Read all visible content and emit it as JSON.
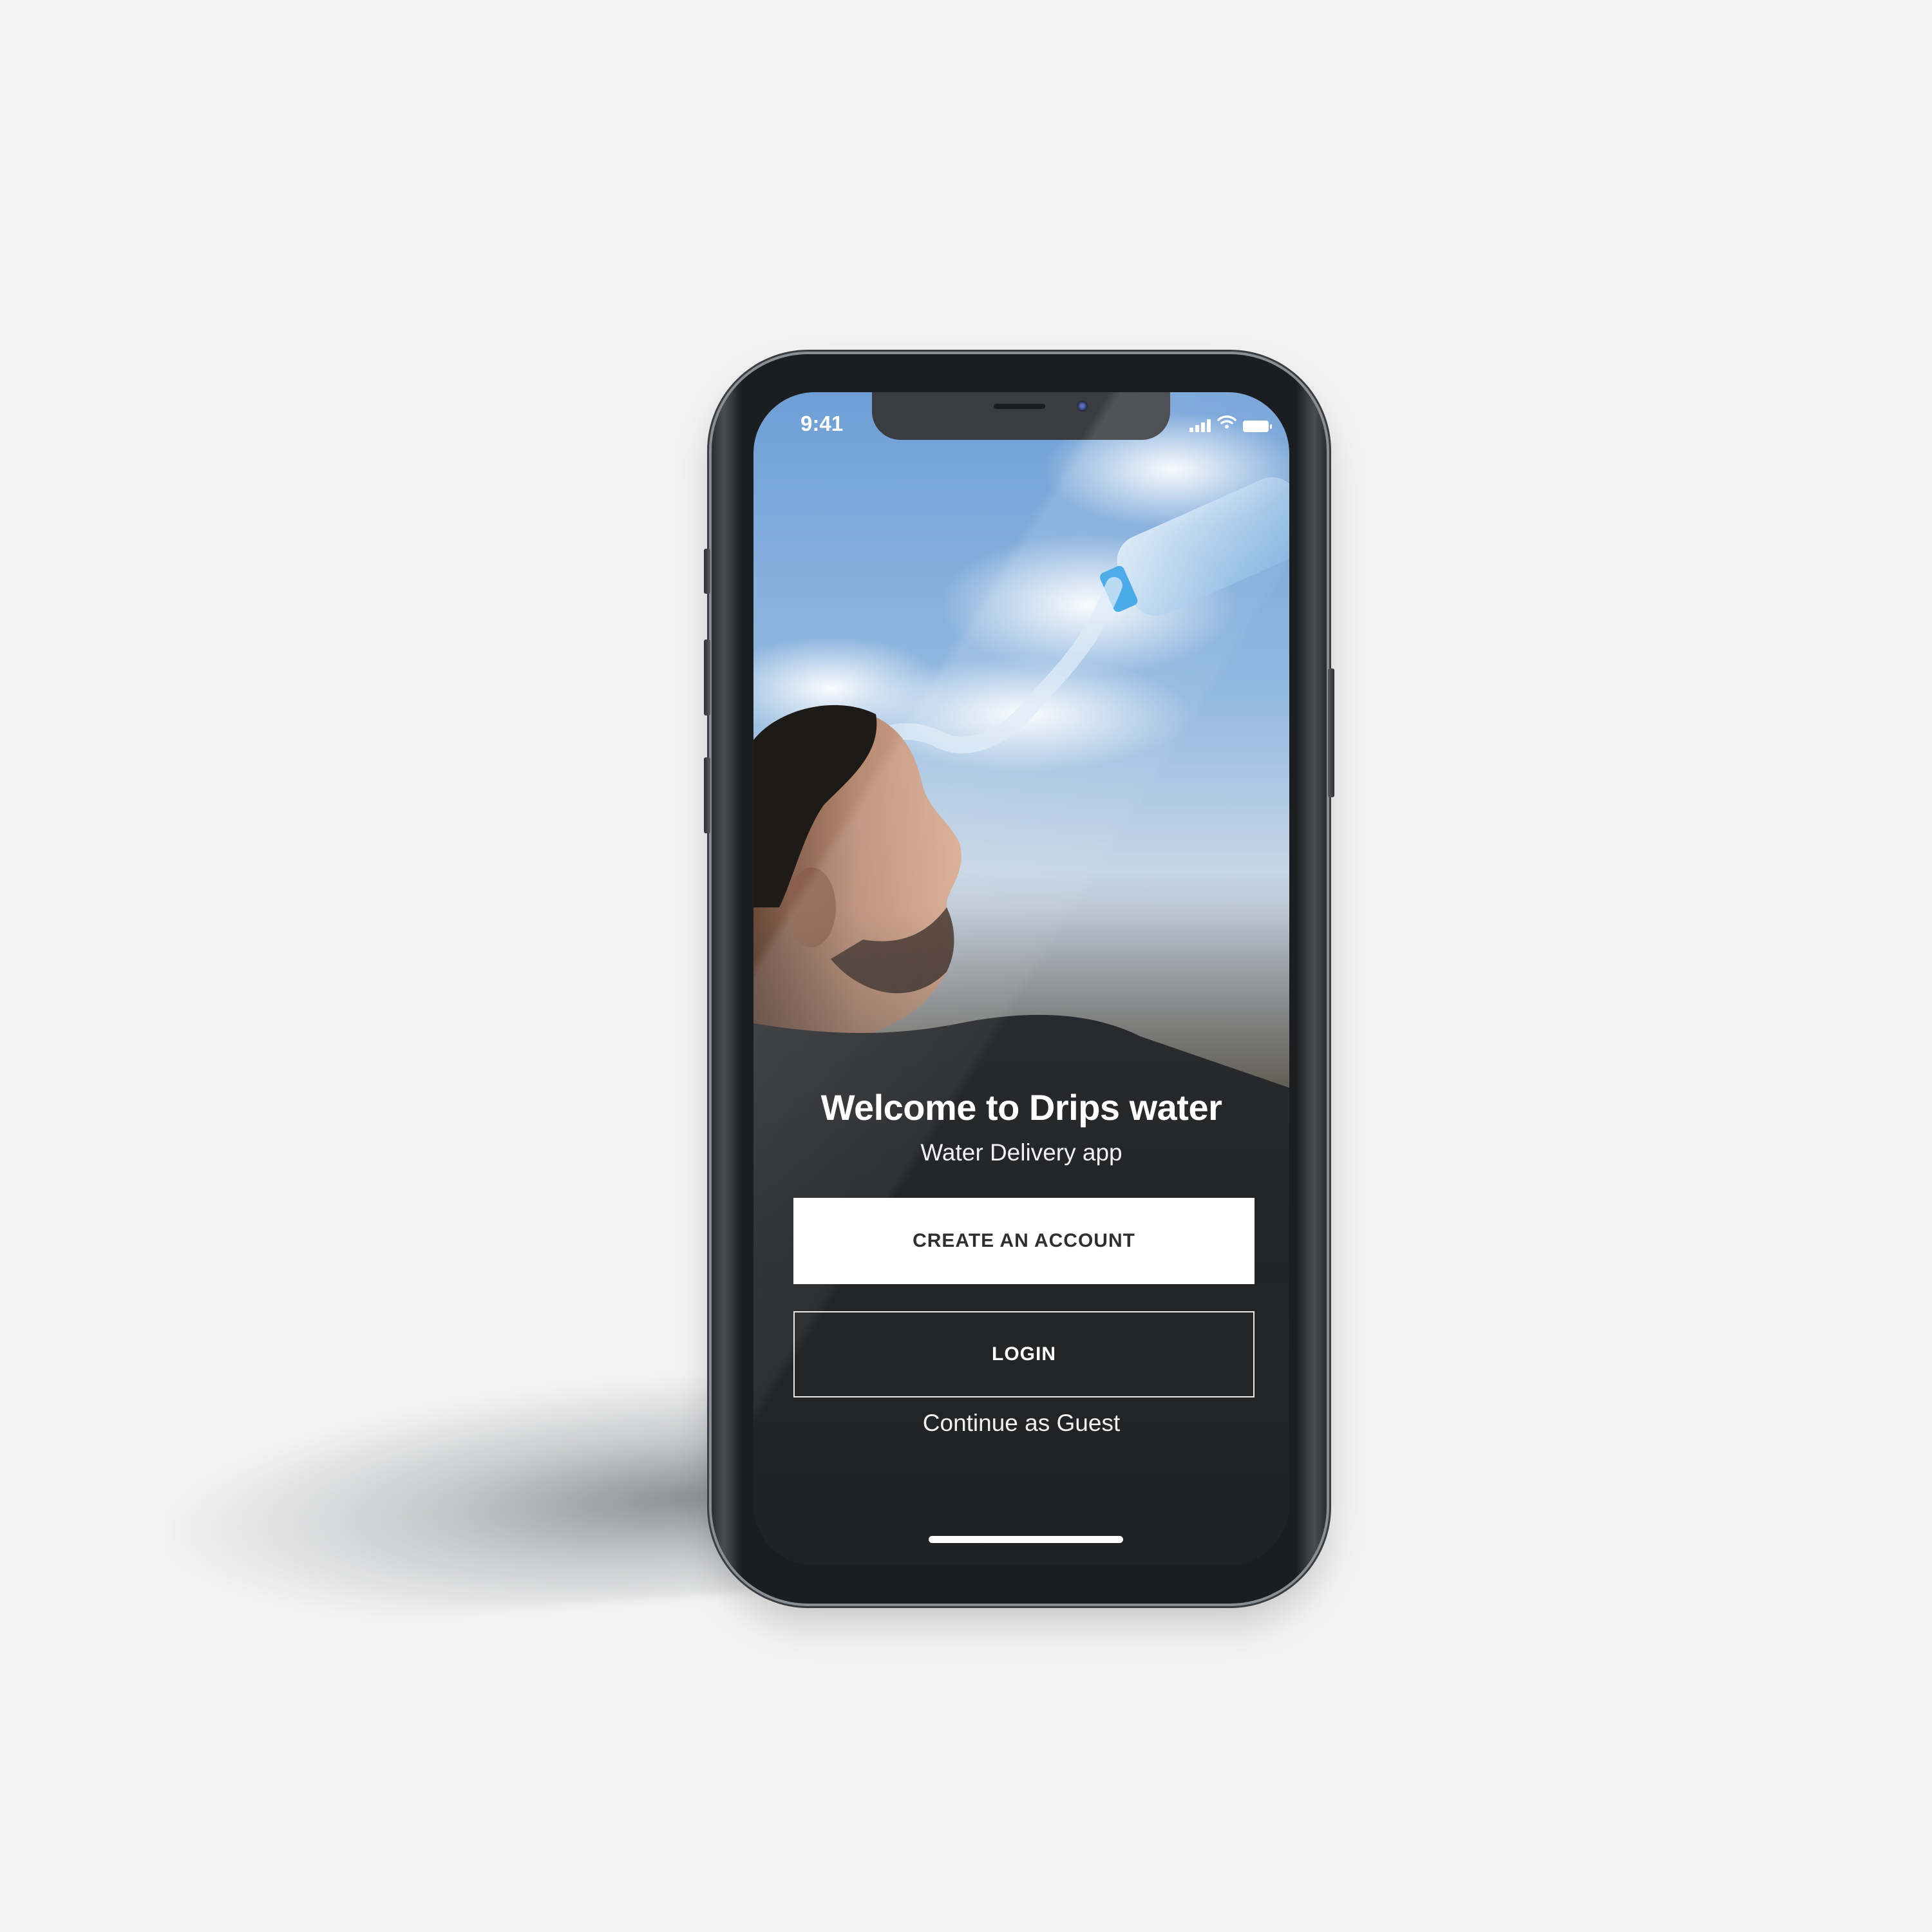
{
  "status_bar": {
    "time": "9:41",
    "signal_icon": "cellular-signal-icon",
    "wifi_icon": "wifi-icon",
    "battery_icon": "battery-icon"
  },
  "welcome": {
    "title": "Welcome to Drips water",
    "subtitle": "Water Delivery app"
  },
  "actions": {
    "create_account_label": "CREATE AN ACCOUNT",
    "login_label": "LOGIN",
    "guest_label": "Continue as Guest"
  },
  "colors": {
    "page_background": "#f3f3f3",
    "screen_background": "#202224",
    "primary_button": "#ffffff",
    "primary_button_text": "#2d2f31",
    "text_light": "#ffffff",
    "sky_blue": "#8fb6dc"
  }
}
